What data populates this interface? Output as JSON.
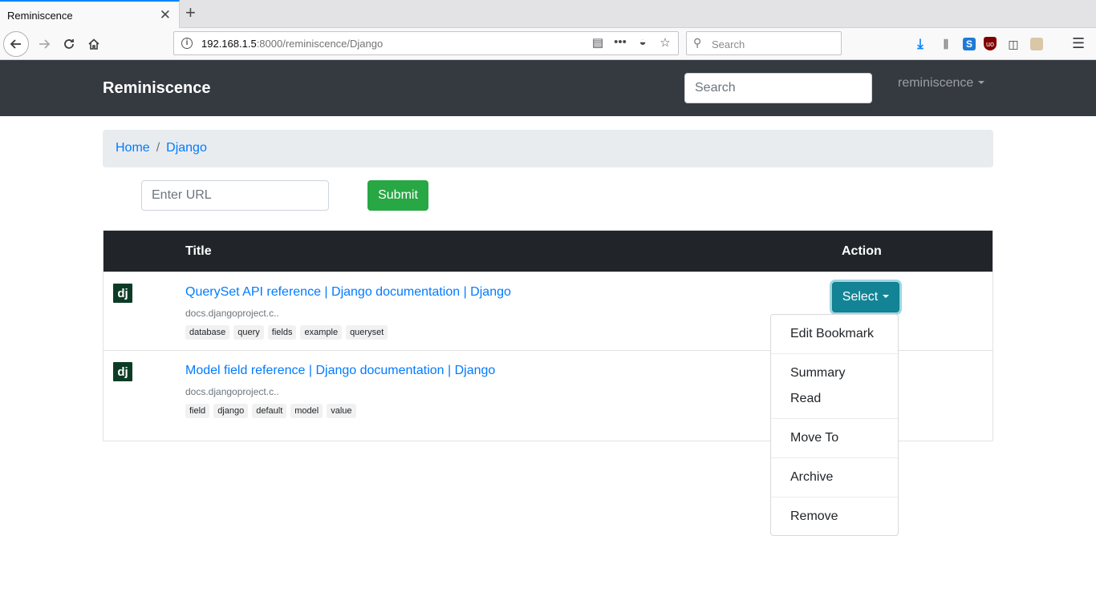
{
  "browser": {
    "tab_title": "Reminiscence",
    "tab_close": "✕",
    "new_tab": "+",
    "url_host": "192.168.1.5",
    "url_path": ":8000/reminiscence/Django",
    "search_placeholder": "Search"
  },
  "app": {
    "brand": "Reminiscence",
    "search_placeholder": "Search",
    "user_menu": "reminiscence"
  },
  "breadcrumb": {
    "home": "Home",
    "separator": "/",
    "current": "Django"
  },
  "form": {
    "url_placeholder": "Enter URL",
    "submit_label": "Submit"
  },
  "table": {
    "headers": {
      "title": "Title",
      "action": "Action"
    },
    "rows": [
      {
        "favicon": "dj",
        "title": "QuerySet API reference | Django documentation | Django",
        "url": "docs.djangoproject.c..",
        "tags": [
          "database",
          "query",
          "fields",
          "example",
          "queryset"
        ]
      },
      {
        "favicon": "dj",
        "title": "Model field reference | Django documentation | Django",
        "url": "docs.djangoproject.c..",
        "tags": [
          "field",
          "django",
          "default",
          "model",
          "value"
        ]
      }
    ],
    "select_label": "Select"
  },
  "dropdown": {
    "items": [
      "Edit Bookmark",
      "Summary",
      "Read",
      "Move To",
      "Archive",
      "Remove"
    ]
  },
  "colors": {
    "navbar": "#343a40",
    "link": "#007bff",
    "success": "#28a745",
    "info": "#17a2b8"
  }
}
